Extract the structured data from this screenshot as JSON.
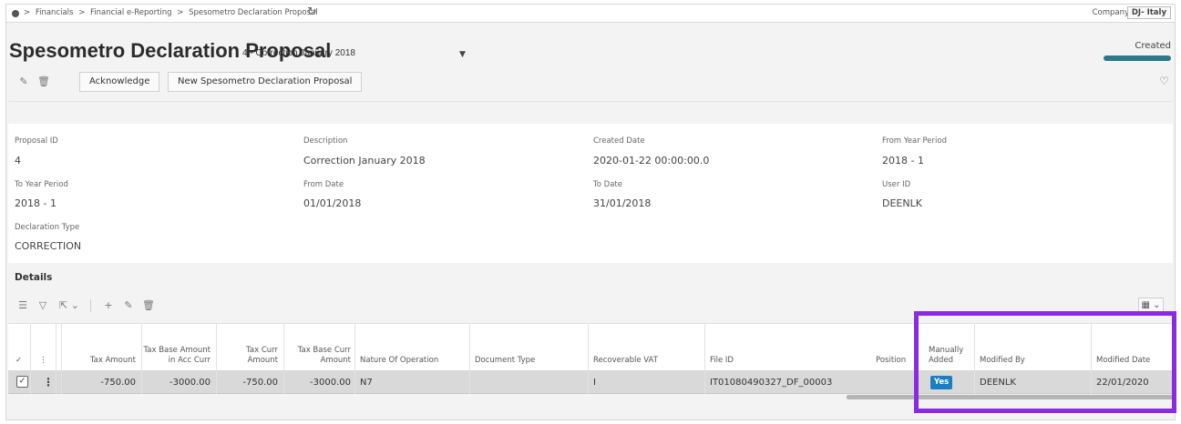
{
  "breadcrumb": {
    "items": [
      ">",
      "Financials",
      ">",
      "Financial e-Reporting",
      ">",
      "Spesometro Declaration Proposal"
    ]
  },
  "company": {
    "label": "Company",
    "value": "DJ- Italy"
  },
  "header": {
    "title": "Spesometro Declaration Proposal",
    "subtitle": "4 - Correction January 2018",
    "status": "Created"
  },
  "toolbar": {
    "acknowledge_label": "Acknowledge",
    "new_label": "New Spesometro Declaration Proposal"
  },
  "fields": [
    {
      "label": "Proposal ID",
      "value": "4"
    },
    {
      "label": "Description",
      "value": "Correction January 2018"
    },
    {
      "label": "Created Date",
      "value": "2020-01-22 00:00:00.0"
    },
    {
      "label": "From Year Period",
      "value": "2018 - 1"
    },
    {
      "label": "To Year Period",
      "value": "2018 - 1"
    },
    {
      "label": "From Date",
      "value": "01/01/2018"
    },
    {
      "label": "To Date",
      "value": "31/01/2018"
    },
    {
      "label": "User ID",
      "value": "DEENLK"
    },
    {
      "label": "Declaration Type",
      "value": "CORRECTION"
    }
  ],
  "details": {
    "title": "Details",
    "columns": [
      "Tax Amount",
      "Tax Base Amount in Acc Curr",
      "Tax Curr Amount",
      "Tax Base Curr Amount",
      "Nature Of Operation",
      "Document Type",
      "Recoverable VAT",
      "File ID",
      "Position",
      "Manually Added",
      "Modified By",
      "Modified Date"
    ],
    "row": {
      "tax_amount": "-750.00",
      "tax_base_acc": "-3000.00",
      "tax_curr": "-750.00",
      "tax_base_curr": "-3000.00",
      "nature": "N7",
      "document_type": "",
      "recoverable_vat": "I",
      "file_id": "IT01080490327_DF_00003",
      "position": "",
      "manually_added": "Yes",
      "modified_by": "DEENLK",
      "modified_date": "22/01/2020"
    }
  },
  "colors": {
    "accent": "#1a7fc1",
    "status_bar": "#2a7a8a",
    "highlight": "#8a2be2"
  }
}
